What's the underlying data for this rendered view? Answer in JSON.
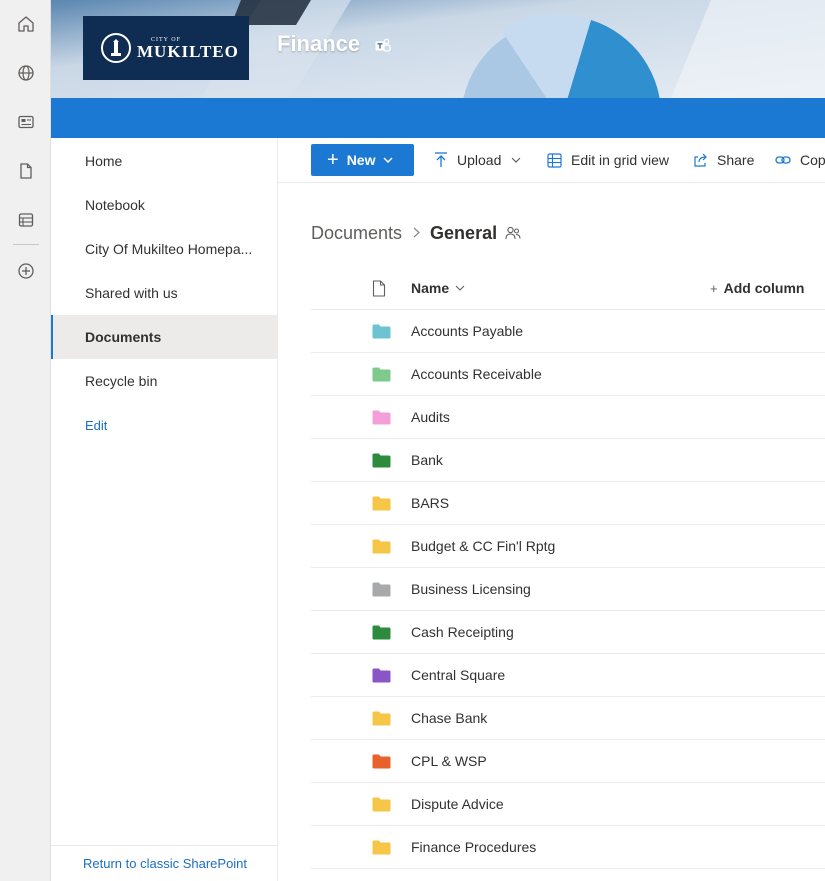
{
  "header": {
    "logo_small": "CITY OF",
    "logo_big": "MUKILTEO",
    "site_title": "Finance"
  },
  "app_bar": {
    "icons": [
      "home-icon",
      "globe-icon",
      "news-icon",
      "document-icon",
      "list-icon",
      "add-circle-icon"
    ]
  },
  "left_nav": {
    "items": [
      {
        "label": "Home"
      },
      {
        "label": "Notebook"
      },
      {
        "label": "City Of Mukilteo Homepa..."
      },
      {
        "label": "Shared with us"
      },
      {
        "label": "Documents",
        "selected": true
      },
      {
        "label": "Recycle bin"
      }
    ],
    "edit_label": "Edit",
    "classic_link": "Return to classic SharePoint"
  },
  "command_bar": {
    "new_label": "New",
    "upload_label": "Upload",
    "grid_label": "Edit in grid view",
    "share_label": "Share",
    "copy_label": "Cop"
  },
  "breadcrumb": {
    "root": "Documents",
    "current": "General"
  },
  "list": {
    "name_header": "Name",
    "add_column": "Add column",
    "folders": [
      {
        "name": "Accounts Payable",
        "color": "#6cc3d1"
      },
      {
        "name": "Accounts Receivable",
        "color": "#7dc98b"
      },
      {
        "name": "Audits",
        "color": "#f29fd9"
      },
      {
        "name": "Bank",
        "color": "#2e8b3d"
      },
      {
        "name": "BARS",
        "color": "#f6c547"
      },
      {
        "name": "Budget & CC Fin'l Rptg",
        "color": "#f6c547"
      },
      {
        "name": "Business Licensing",
        "color": "#a7a9ab"
      },
      {
        "name": "Cash Receipting",
        "color": "#2e8b3d"
      },
      {
        "name": "Central Square",
        "color": "#8a55c7"
      },
      {
        "name": "Chase Bank",
        "color": "#f6c547"
      },
      {
        "name": "CPL & WSP",
        "color": "#e8622e"
      },
      {
        "name": "Dispute Advice",
        "color": "#f6c547"
      },
      {
        "name": "Finance Procedures",
        "color": "#f6c547"
      }
    ]
  },
  "colors": {
    "accent": "#1b79d4",
    "logo_bg": "#0f2c52",
    "link": "#1b6fc1"
  }
}
